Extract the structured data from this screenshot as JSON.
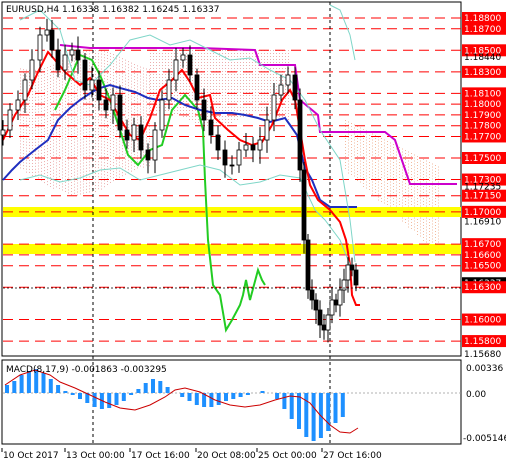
{
  "header": {
    "symbol": "EURUSD,H4",
    "open": "1.16338",
    "high": "1.16382",
    "low": "1.16245",
    "close": "1.16337"
  },
  "macd": {
    "label": "MACD(8,17,9)",
    "main": "-0.001863",
    "signal": "-0.003295",
    "scale_top": "0.00336",
    "scale_zero": "0.00",
    "scale_bottom": "-0.005146"
  },
  "levels": [
    {
      "price": "1.18800",
      "style": "red"
    },
    {
      "price": "1.18700",
      "style": "red"
    },
    {
      "price": "1.18500",
      "style": "red"
    },
    {
      "price": "1.18440",
      "style": "plain"
    },
    {
      "price": "1.18300",
      "style": "red"
    },
    {
      "price": "1.18100",
      "style": "red"
    },
    {
      "price": "1.18000",
      "style": "red"
    },
    {
      "price": "1.17900",
      "style": "red"
    },
    {
      "price": "1.17800",
      "style": "red"
    },
    {
      "price": "1.17700",
      "style": "red"
    },
    {
      "price": "1.17500",
      "style": "red"
    },
    {
      "price": "1.17300",
      "style": "red"
    },
    {
      "price": "1.17235",
      "style": "plain"
    },
    {
      "price": "1.17150",
      "style": "red"
    },
    {
      "price": "1.17000",
      "style": "red"
    },
    {
      "price": "1.16910",
      "style": "plain"
    },
    {
      "price": "1.16700",
      "style": "red"
    },
    {
      "price": "1.16600",
      "style": "red"
    },
    {
      "price": "1.16500",
      "style": "red"
    },
    {
      "price": "1.16337",
      "style": "black"
    },
    {
      "price": "1.16300",
      "style": "red"
    },
    {
      "price": "1.16000",
      "style": "red"
    },
    {
      "price": "1.15800",
      "style": "red"
    },
    {
      "price": "1.15680",
      "style": "plain"
    }
  ],
  "time_axis": [
    "10 Oct 2017",
    "13 Oct 00:00",
    "17 Oct 16:00",
    "20 Oct 08:00",
    "25 Oct 00:00",
    "27 Oct 16:00"
  ],
  "colors": {
    "background": "#ffffff",
    "level_line": "#ff0000",
    "yellow_zone": "#ffff00",
    "bull_candle": "#000000",
    "ma_red": "#ff0000",
    "ma_blue": "#1f2fbf",
    "ma_magenta": "#cc00cc",
    "green_line": "#22cc22",
    "macd_hist": "#1e90ff",
    "macd_signal": "#cc0000"
  }
}
